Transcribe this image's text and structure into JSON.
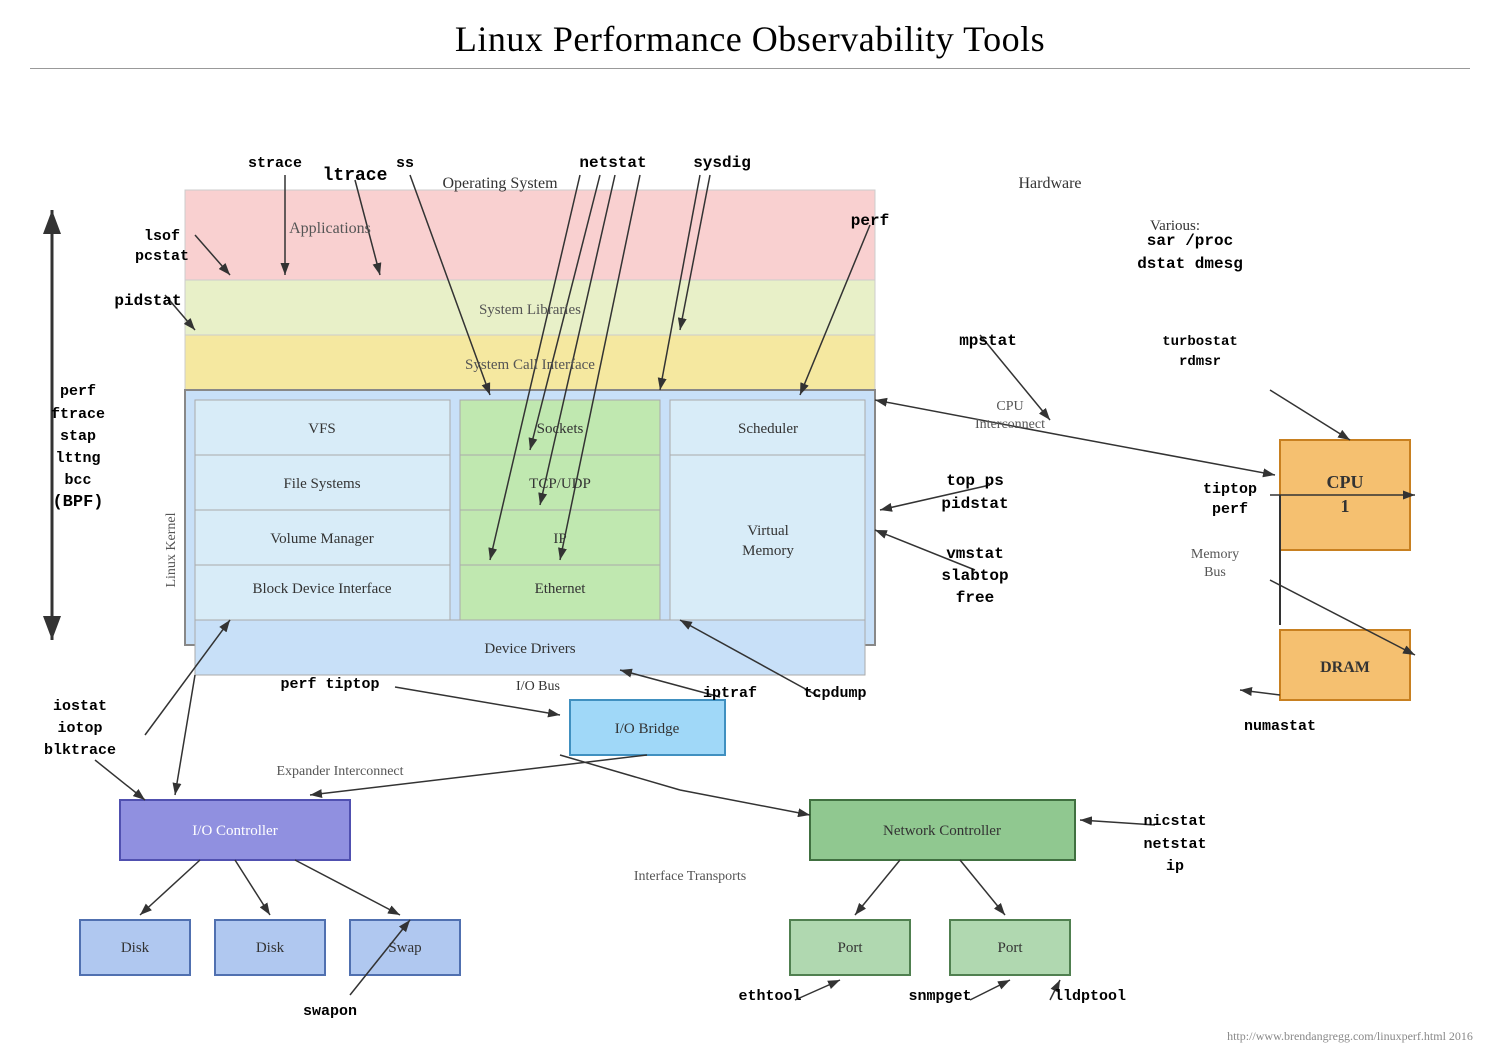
{
  "title": "Linux Performance Observability Tools",
  "subtitle": "http://www.brendangregg.com/linuxperf.html 2016",
  "sections": {
    "os_label": "Operating System",
    "hw_label": "Hardware",
    "various_label": "Various:",
    "linux_kernel_label": "Linux Kernel",
    "cpu_interconnect_label": "CPU\nInterconnect",
    "memory_bus_label": "Memory\nBus",
    "expander_interconnect_label": "Expander Interconnect",
    "interface_transports_label": "Interface Transports"
  },
  "layers": {
    "applications": "Applications",
    "system_libraries": "System Libraries",
    "syscall_interface": "System Call Interface",
    "vfs": "VFS",
    "file_systems": "File Systems",
    "volume_manager": "Volume Manager",
    "block_device_interface": "Block Device Interface",
    "device_drivers": "Device Drivers",
    "sockets": "Sockets",
    "tcp_udp": "TCP/UDP",
    "ip": "IP",
    "ethernet": "Ethernet",
    "scheduler": "Scheduler",
    "virtual_memory": "Virtual\nMemory"
  },
  "hardware_boxes": {
    "cpu": "CPU\n1",
    "dram": "DRAM",
    "io_bridge": "I/O Bridge",
    "io_controller": "I/O Controller",
    "disk1": "Disk",
    "disk2": "Disk",
    "swap": "Swap",
    "network_controller": "Network Controller",
    "port1": "Port",
    "port2": "Port"
  },
  "tools": {
    "strace": "strace",
    "ss": "ss",
    "ltrace": "ltrace",
    "lsof": "lsof",
    "pcstat": "pcstat",
    "pidstat": "pidstat",
    "netstat": "netstat",
    "sysdig": "sysdig",
    "perf_top": "perf",
    "mpstat": "mpstat",
    "top_ps": "top ps",
    "pidstat2": "pidstat",
    "vmstat": "vmstat",
    "slabtop": "slabtop",
    "free": "free",
    "perf_ftrace": "perf\nftrace",
    "stap": "stap",
    "lttng": "lttng",
    "bcc_bpf": "bcc\n(BPF)",
    "sar_proc": "sar /proc",
    "dstat_dmesg": "dstat dmesg",
    "turbostat": "turbostat",
    "rdmsr": "rdmsr",
    "tiptop": "tiptop",
    "perf_hw": "perf",
    "numastat": "numastat",
    "iostat": "iostat",
    "iotop": "iotop",
    "blktrace": "blktrace",
    "perf_tiptop": "perf tiptop",
    "iptraf": "iptraf",
    "tcpdump": "tcpdump",
    "swapon": "swapon",
    "nicstat": "nicstat",
    "netstat2": "netstat",
    "ip_tool": "ip",
    "ethtool": "ethtool",
    "snmpget": "snmpget",
    "lldptool": "lldptool",
    "io_bus": "I/O Bus"
  }
}
